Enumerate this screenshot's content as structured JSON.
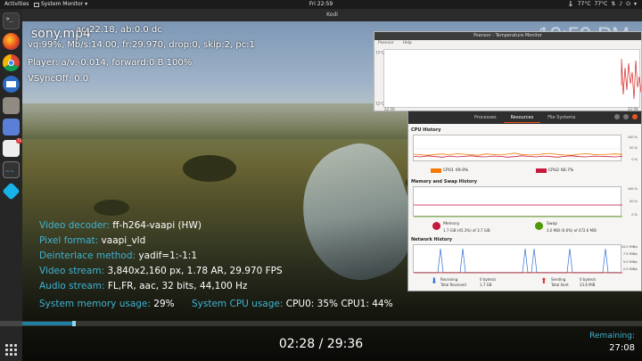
{
  "topbar": {
    "activities": "Activities",
    "app_menu": "System Monitor",
    "clock": "Fri 22:59",
    "temperature": "77°C",
    "cpu_temp": "77°C"
  },
  "kodi": {
    "window_title": "Kodi",
    "clock": "10:59 PM",
    "filename": "sony.mp4",
    "debug_lines": [
      "ac:22.18, ab:0.0 dc",
      "vq:99%, Mb/s:14.00, fr:29.970, drop:0, skip:2, pc:1",
      "Player: a/v:-0.014, forward:0 B 100%",
      "VSyncOff: 0.0"
    ],
    "info": [
      {
        "label": "Video decoder:",
        "value": "ff-h264-vaapi (HW)"
      },
      {
        "label": "Pixel format:",
        "value": "vaapi_vld"
      },
      {
        "label": "Deinterlace method:",
        "value": "yadif=1:-1:1"
      },
      {
        "label": "Video stream:",
        "value": "3,840x2,160 px, 1.78 AR, 29.970 FPS"
      },
      {
        "label": "Audio stream:",
        "value": "FL,FR, aac, 32 bits, 44,100 Hz"
      },
      {
        "label": "System memory usage:",
        "value": "29%"
      }
    ],
    "cpu_info": {
      "label": "System CPU usage:",
      "value": "CPU0:  35% CPU1:  44%"
    },
    "time_display": "02:28 / 29:36",
    "remaining_label": "Remaining:",
    "remaining_value": "27:08",
    "progress": 0.083
  },
  "psensor": {
    "title": "Psensor - Temperature Monitor",
    "menu": [
      "Psensor",
      "Help"
    ],
    "y_top": "77°C",
    "y_bottom": "72°C",
    "x_left": "22:50",
    "x_right": "22:59"
  },
  "sysmon": {
    "tabs": [
      "Processes",
      "Resources",
      "File Systems"
    ],
    "active_tab": "Resources",
    "cpu": {
      "title": "CPU History",
      "axis_right": [
        "100 %",
        "50 %",
        "0 %"
      ],
      "legend": [
        {
          "name": "CPU1",
          "value": "69.9%",
          "color": "#f57900"
        },
        {
          "name": "CPU2",
          "value": "66.7%",
          "color": "#c4183c"
        }
      ],
      "cpu1": [
        30,
        28,
        26,
        29,
        31,
        27,
        32,
        30,
        28,
        26,
        31,
        29,
        27,
        30,
        34,
        29,
        27,
        28,
        31,
        33,
        29,
        27,
        26,
        30,
        32,
        29,
        28,
        30,
        31,
        29
      ],
      "cpu2": [
        22,
        20,
        24,
        21,
        19,
        23,
        20,
        22,
        24,
        21,
        20,
        23,
        22,
        19,
        21,
        24,
        22,
        20,
        23,
        21,
        19,
        22,
        24,
        21,
        20,
        23,
        22,
        21,
        20,
        22
      ]
    },
    "mem": {
      "title": "Memory and Swap History",
      "axis_right": [
        "100 %",
        "50 %",
        "0 %"
      ],
      "memory_label": "Memory",
      "memory_value": "1.7 GiB (45.3%) of 3.7 GiB",
      "swap_label": "Swap",
      "swap_value": "3.0 MiB (0.6%) of 472.6 MiB"
    },
    "net": {
      "title": "Network History",
      "axis_right": [
        "10.0 MiB/s",
        "7.5 MiB/s",
        "5.0 MiB/s",
        "2.5 MiB/s"
      ],
      "receiving_label": "Receiving",
      "receiving_rate": "0 bytes/s",
      "total_received_label": "Total Received",
      "total_received": "1.7 GB",
      "sending_label": "Sending",
      "sending_rate": "0 bytes/s",
      "total_sent_label": "Total Sent",
      "total_sent": "23.6 MiB"
    },
    "time_axis": [
      "60 seconds",
      "50",
      "40",
      "30",
      "20",
      "10",
      "0"
    ]
  }
}
